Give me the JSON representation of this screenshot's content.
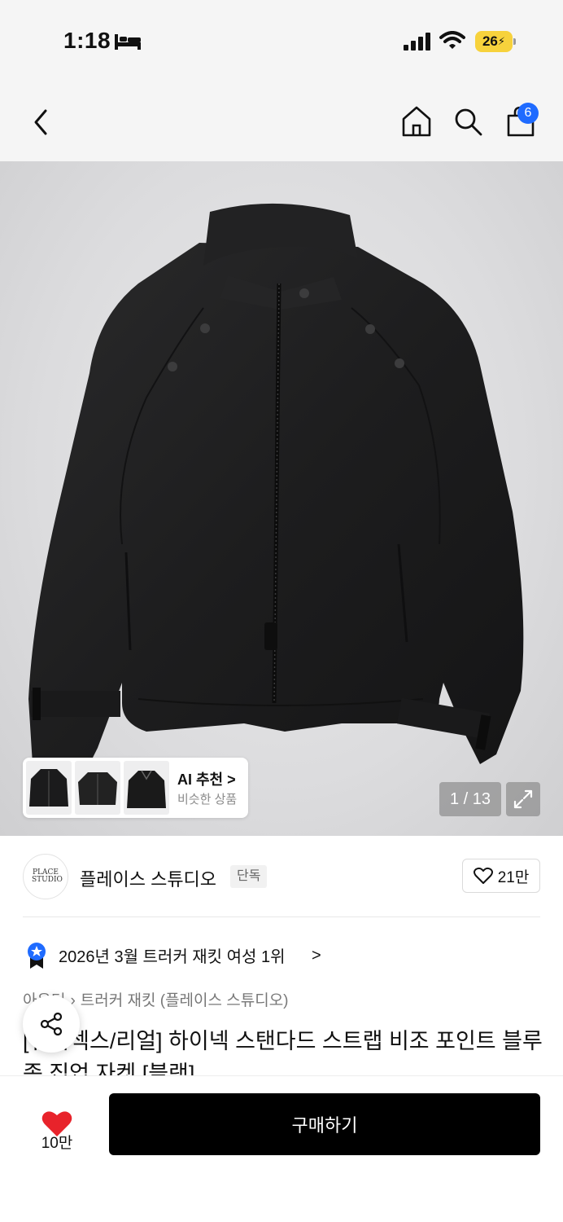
{
  "status_bar": {
    "time": "1:18",
    "battery": "26"
  },
  "header": {
    "cart_count": "6"
  },
  "gallery": {
    "counter": "1 / 13",
    "ai": {
      "title": "AI 추천 >",
      "subtitle": "비슷한 상품"
    }
  },
  "brand": {
    "logo_text": "PLACE STUDIO",
    "name": "플레이스 스튜디오",
    "tag": "단독",
    "likes": "21만"
  },
  "ranking": {
    "text": "2026년 3월 트러커 재킷 여성 1위",
    "chevron": ">"
  },
  "breadcrumb": {
    "level1": "아우터",
    "level2": "트러커 재킷 (플레이스 스튜디오)"
  },
  "product": {
    "title": "[유니섹스/리얼] 하이넥 스탠다드 스트랩 비조 포인트 블루종 집업 자켓 [블랙]"
  },
  "bottom": {
    "heart_count": "10만",
    "buy_label": "구매하기"
  },
  "colors": {
    "accent_blue": "#1f6bff",
    "heart_red": "#e8232b",
    "battery_yellow": "#f7d23c",
    "buy_black": "#000000"
  },
  "icons": [
    "bed-icon",
    "signal-icon",
    "wifi-icon",
    "back-icon",
    "home-icon",
    "search-icon",
    "cart-icon",
    "expand-icon",
    "heart-outline-icon",
    "rank-badge-icon",
    "share-icon",
    "heart-filled-icon"
  ]
}
